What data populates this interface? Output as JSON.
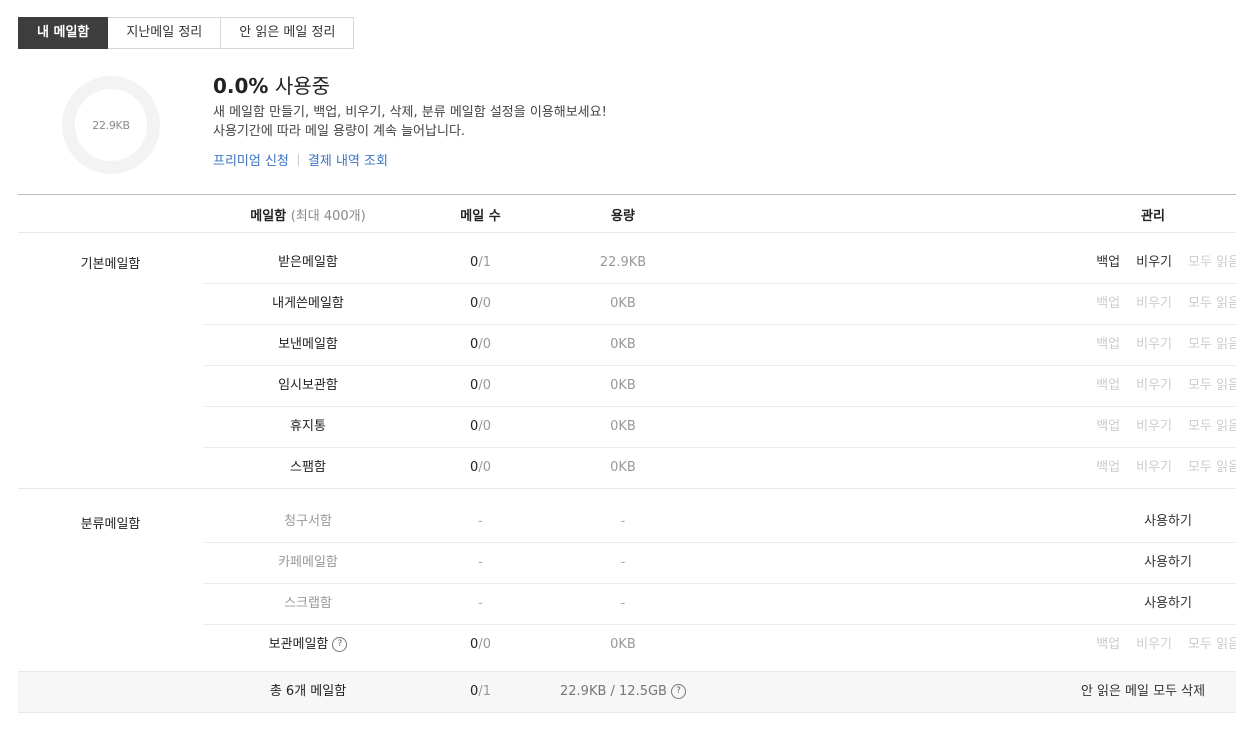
{
  "tabs": [
    "내 메일함",
    "지난메일 정리",
    "안 읽은 메일 정리"
  ],
  "usage": {
    "donut_label": "22.9KB",
    "percent": "0.0%",
    "percent_suffix": "사용중",
    "desc_line1": "새 메일함 만들기, 백업, 비우기, 삭제, 분류 메일함 설정을 이용해보세요!",
    "desc_line2": "사용기간에 따라 메일 용량이 계속 늘어납니다.",
    "link_premium": "프리미엄 신청",
    "link_payment": "결제 내역 조회"
  },
  "table": {
    "col_name": "메일함",
    "col_name_sub": "(최대 400개)",
    "col_count": "메일 수",
    "col_size": "용량",
    "col_manage": "관리"
  },
  "actions": {
    "backup": "백업",
    "empty": "비우기",
    "read_all": "모두 읽음",
    "use": "사용하기"
  },
  "help_icon": "?",
  "groups": {
    "basic": {
      "label": "기본메일함",
      "rows": [
        {
          "name": "받은메일함",
          "count": "0",
          "total": "/1",
          "size": "22.9KB"
        },
        {
          "name": "내게쓴메일함",
          "count": "0",
          "total": "/0",
          "size": "0KB"
        },
        {
          "name": "보낸메일함",
          "count": "0",
          "total": "/0",
          "size": "0KB"
        },
        {
          "name": "임시보관함",
          "count": "0",
          "total": "/0",
          "size": "0KB"
        },
        {
          "name": "휴지통",
          "count": "0",
          "total": "/0",
          "size": "0KB"
        },
        {
          "name": "스팸함",
          "count": "0",
          "total": "/0",
          "size": "0KB"
        }
      ]
    },
    "category": {
      "label": "분류메일함",
      "rows": [
        {
          "name": "청구서함",
          "count": "-",
          "size": "-"
        },
        {
          "name": "카페메일함",
          "count": "-",
          "size": "-"
        },
        {
          "name": "스크랩함",
          "count": "-",
          "size": "-"
        },
        {
          "name": "보관메일함",
          "count": "0",
          "total": "/0",
          "size": "0KB"
        }
      ]
    }
  },
  "summary": {
    "name": "총 6개 메일함",
    "count": "0",
    "total": "/1",
    "size": "22.9KB / 12.5GB",
    "delete_unread": "안 읽은 메일 모두 삭제"
  }
}
